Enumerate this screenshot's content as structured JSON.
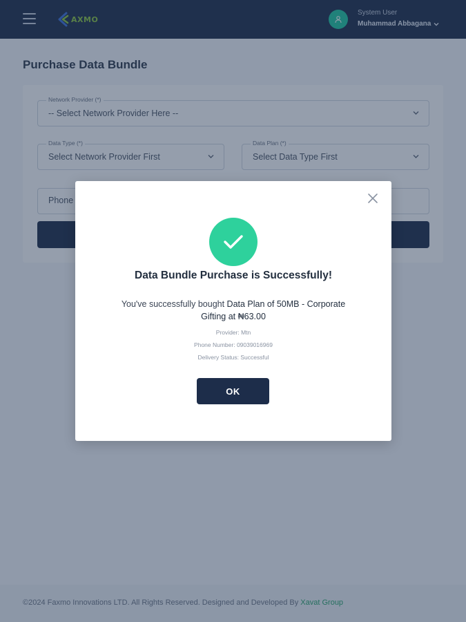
{
  "header": {
    "logo_text": "AXMO",
    "user_role": "System User",
    "user_name": "Muhammad Abbagana"
  },
  "page": {
    "title": "Purchase Data Bundle"
  },
  "form": {
    "network_provider": {
      "label": "Network Provider (*)",
      "value": "-- Select Network Provider Here --"
    },
    "data_type": {
      "label": "Data Type (*)",
      "value": "Select Network Provider First"
    },
    "data_plan": {
      "label": "Data Plan (*)",
      "value": "Select Data Type First"
    },
    "phone": {
      "placeholder": "Phone"
    }
  },
  "modal": {
    "title": "Data Bundle Purchase is Successfully!",
    "message_prefix": "You've successfully bought ",
    "message_plan": "Data Plan of 50MB - Corporate Gifting at ₦63.00",
    "provider": "Provider: Mtn",
    "phone_number": "Phone Number: 09039016969",
    "delivery_status": "Delivery Status: Successful",
    "ok_label": "OK"
  },
  "footer": {
    "text": "©2024 Faxmo Innovations LTD. All Rights Reserved. Designed and Developed By ",
    "link": "Xavat Group"
  },
  "colors": {
    "header_bg": "#1d2d4a",
    "accent_green": "#2ed19c",
    "logo_green": "#8cc63f",
    "avatar_bg": "#1fc8a0",
    "footer_link": "#2aa56b"
  },
  "icons": {
    "menu": "hamburger-menu-icon",
    "user": "user-icon",
    "dropdown": "chevron-down-icon",
    "close": "close-icon",
    "success": "checkmark-icon"
  }
}
